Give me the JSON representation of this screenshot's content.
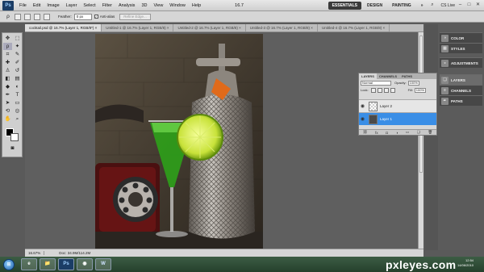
{
  "menubar": {
    "logo": "Ps",
    "items": [
      "File",
      "Edit",
      "Image",
      "Layer",
      "Select",
      "Filter",
      "Analysis",
      "3D",
      "View",
      "Window",
      "Help"
    ],
    "zoom": "16.7",
    "workspaces": [
      "ESSENTIALS",
      "DESIGN",
      "PAINTING"
    ],
    "workspace_more": "»",
    "cs_live": "CS Live",
    "window_controls": [
      "–",
      "□",
      "✕"
    ]
  },
  "options": {
    "feather_label": "Feather:",
    "feather_value": "0 px",
    "antialias_label": "Anti-alias",
    "refine_edge": "Refine Edge..."
  },
  "doc_tabs": [
    "cocktail.psd @ 16.7% (Layer 1, RGB/8*) ×",
    "Untitled-1 @ 16.7% (Layer 1, RGB/8) ×",
    "Untitled-2 @ 16.7% (Layer 1, RGB/8) ×",
    "Untitled-3 @ 16.7% (Layer 1, RGB/8) ×",
    "Untitled-4 @ 16.7% (Layer 1, RGB/8) ×"
  ],
  "status": {
    "zoom": "16.67%",
    "doc": "Doc: 34.9M/114.2M"
  },
  "right_panels": {
    "group1": [
      {
        "icon": "color-icon",
        "label": "COLOR"
      },
      {
        "icon": "styles-icon",
        "label": "STYLES"
      }
    ],
    "group2": [
      {
        "icon": "adjustments-icon",
        "label": "ADJUSTMENTS"
      }
    ],
    "group3": [
      {
        "icon": "layers-icon",
        "label": "LAYERS"
      },
      {
        "icon": "channels-icon",
        "label": "CHANNELS"
      },
      {
        "icon": "paths-icon",
        "label": "PATHS"
      }
    ]
  },
  "layers": {
    "tabs": [
      "LAYERS",
      "CHANNELS",
      "PATHS"
    ],
    "blend_mode": "Normal",
    "opacity_label": "Opacity:",
    "opacity_value": "100%",
    "lock_label": "Lock:",
    "fill_label": "Fill:",
    "fill_value": "100%",
    "items": [
      {
        "name": "Layer 2",
        "selected": false
      },
      {
        "name": "Layer 1",
        "selected": true
      }
    ]
  },
  "taskbar": {
    "start": "⊞",
    "apps": [
      "e",
      "📁",
      "Ps",
      "◉",
      "W"
    ],
    "watermark": "pxleyes.com",
    "time": "12:54",
    "date": "14/06/2010"
  },
  "colors": {
    "accent_selection": "#3a8ee6",
    "taskbar": "#2e4a35",
    "ps_logo": "#1b3d66"
  }
}
